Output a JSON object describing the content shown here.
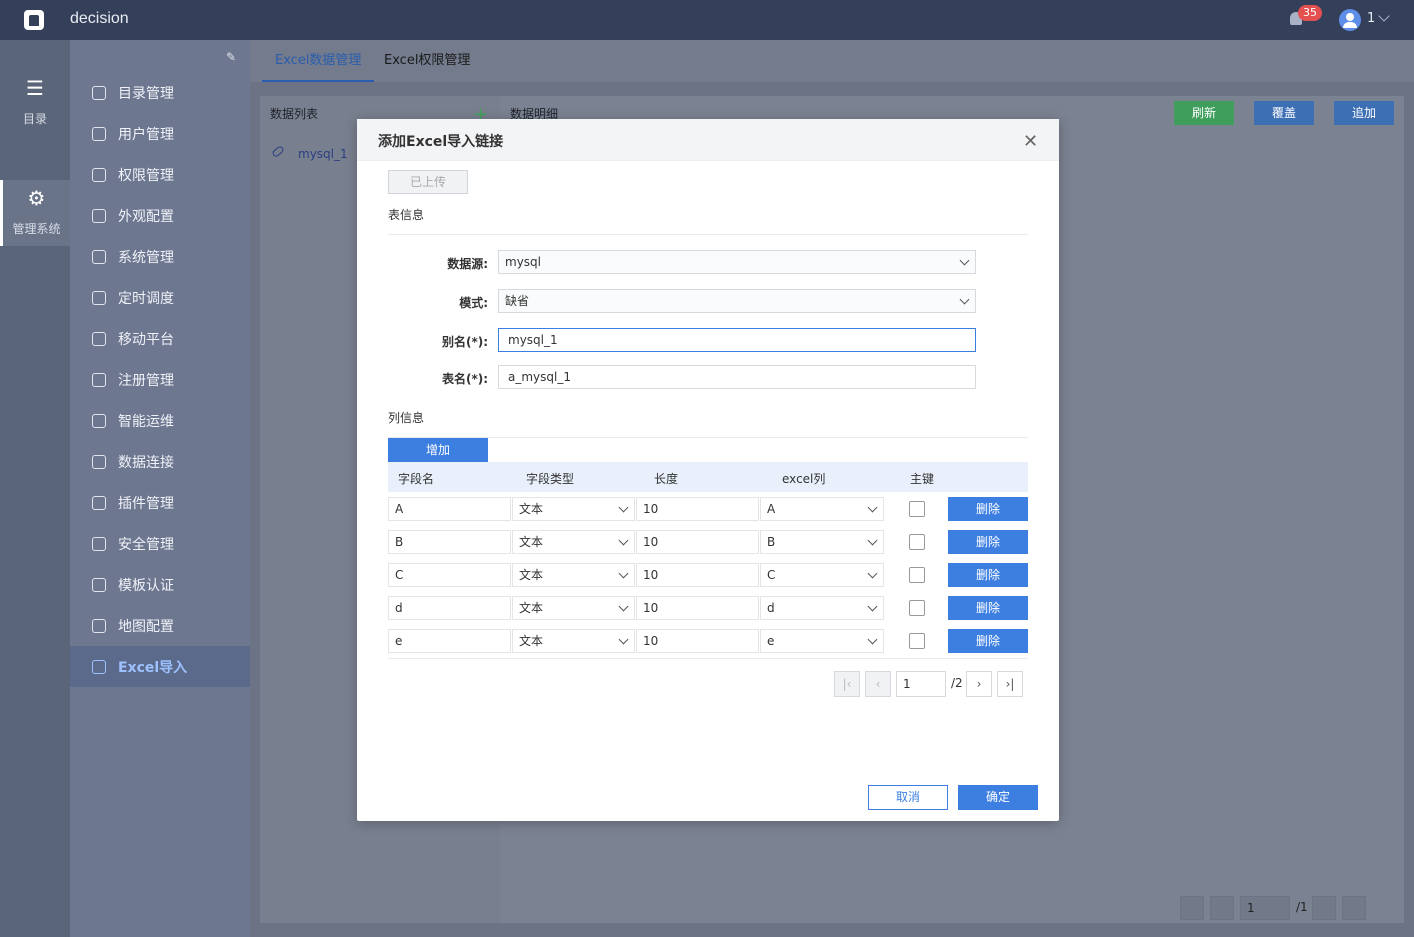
{
  "app": {
    "name": "decision",
    "notifications": "35",
    "user": "1"
  },
  "rail": [
    {
      "label": "目录"
    },
    {
      "label": "管理系统"
    }
  ],
  "menu": [
    {
      "label": "目录管理"
    },
    {
      "label": "用户管理"
    },
    {
      "label": "权限管理"
    },
    {
      "label": "外观配置"
    },
    {
      "label": "系统管理"
    },
    {
      "label": "定时调度"
    },
    {
      "label": "移动平台"
    },
    {
      "label": "注册管理"
    },
    {
      "label": "智能运维"
    },
    {
      "label": "数据连接"
    },
    {
      "label": "插件管理"
    },
    {
      "label": "安全管理"
    },
    {
      "label": "模板认证"
    },
    {
      "label": "地图配置"
    },
    {
      "label": "Excel导入"
    }
  ],
  "tabs": [
    {
      "label": "Excel数据管理"
    },
    {
      "label": "Excel权限管理"
    }
  ],
  "left_panel": {
    "title": "数据列表",
    "items": [
      {
        "label": "mysql_1"
      }
    ]
  },
  "right_panel": {
    "title": "数据明细",
    "refresh": "刷新",
    "overwrite": "覆盖",
    "append": "追加",
    "page": "1",
    "total": "/1"
  },
  "colors": {
    "refresh": "#3f9e5c",
    "overwrite": "#3d6fb5",
    "append": "#3d6fb5"
  },
  "modal": {
    "title": "添加Excel导入链接",
    "uploaded": "已上传",
    "table_info": "表信息",
    "datasource_label": "数据源:",
    "datasource_value": "mysql",
    "schema_label": "模式:",
    "schema_value": "缺省",
    "alias_label": "别名(*):",
    "alias_value": "mysql_1",
    "tablename_label": "表名(*):",
    "tablename_value": "a_mysql_1",
    "column_info": "列信息",
    "add_button": "增加",
    "headers": [
      "字段名",
      "字段类型",
      "长度",
      "excel列",
      "主键"
    ],
    "rows": [
      {
        "name": "A",
        "type": "文本",
        "length": "10",
        "excel": "A",
        "delete": "删除"
      },
      {
        "name": "B",
        "type": "文本",
        "length": "10",
        "excel": "B",
        "delete": "删除"
      },
      {
        "name": "C",
        "type": "文本",
        "length": "10",
        "excel": "C",
        "delete": "删除"
      },
      {
        "name": "d",
        "type": "文本",
        "length": "10",
        "excel": "d",
        "delete": "删除"
      },
      {
        "name": "e",
        "type": "文本",
        "length": "10",
        "excel": "e",
        "delete": "删除"
      }
    ],
    "pager": {
      "page": "1",
      "total": "/2"
    },
    "cancel": "取消",
    "confirm": "确定"
  }
}
